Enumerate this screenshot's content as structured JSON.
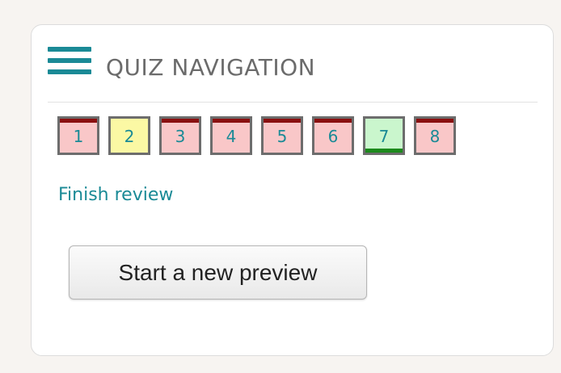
{
  "block": {
    "title": "QUIZ NAVIGATION",
    "menu_icon": "hamburger-icon"
  },
  "questions": [
    {
      "label": "1",
      "state": "incorrect"
    },
    {
      "label": "2",
      "state": "partial"
    },
    {
      "label": "3",
      "state": "incorrect"
    },
    {
      "label": "4",
      "state": "incorrect"
    },
    {
      "label": "5",
      "state": "incorrect"
    },
    {
      "label": "6",
      "state": "incorrect"
    },
    {
      "label": "7",
      "state": "correct"
    },
    {
      "label": "8",
      "state": "incorrect"
    }
  ],
  "links": {
    "finish_review": "Finish review"
  },
  "actions": {
    "start_preview": "Start a new preview"
  },
  "colors": {
    "accent": "#1a8a96",
    "incorrect_bg": "#f9c7c8",
    "incorrect_bar": "#8a1010",
    "partial_bg": "#fbf8a4",
    "correct_bg": "#caf6cd",
    "correct_bar": "#1d8a1d"
  }
}
